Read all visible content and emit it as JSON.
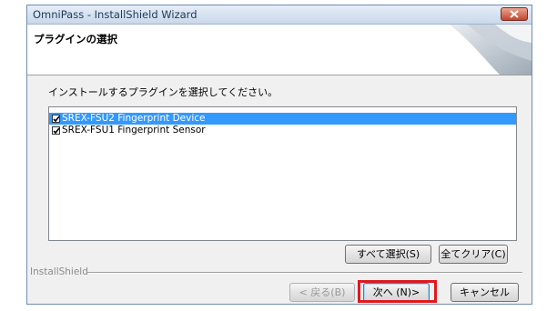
{
  "window": {
    "title": "OmniPass - InstallShield Wizard"
  },
  "header": {
    "title": "プラグインの選択"
  },
  "instruction": "インストールするプラグインを選択してください。",
  "plugins": [
    {
      "label": "SREX-FSU2 Fingerprint Device",
      "checked": true,
      "selected": true
    },
    {
      "label": "SREX-FSU1 Fingerprint Sensor",
      "checked": true,
      "selected": false
    }
  ],
  "buttons": {
    "select_all": "すべて選択(S)",
    "clear_all": "全てクリア(C)",
    "back": "< 戻る(B)",
    "next": "次へ (N)>",
    "cancel": "キャンセル"
  },
  "footer": {
    "brand": "InstallShield"
  },
  "colors": {
    "selection": "#3399ff",
    "highlight_box": "#e0191f"
  }
}
